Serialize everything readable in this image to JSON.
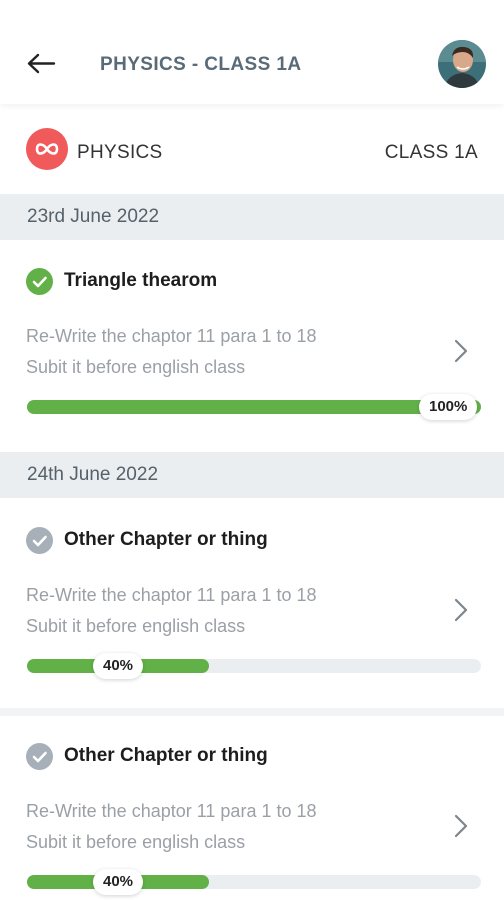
{
  "header": {
    "title": "PHYSICS - CLASS 1A",
    "back_icon": "arrow-left-icon",
    "avatar_icon": "user-avatar"
  },
  "subject": {
    "name": "PHYSICS",
    "class": "CLASS 1A",
    "logo_icon": "infinity-icon",
    "logo_color": "#f05a5a"
  },
  "colors": {
    "progress": "#62b148",
    "done": "#62b148",
    "pending": "#a7b0b8",
    "accent": "#5a6b78"
  },
  "groups": [
    {
      "date": "23rd June 2022",
      "tasks": [
        {
          "title": "Triangle thearom",
          "line1": "Re-Write the chaptor 11 para 1 to 18",
          "line2": "Subit it before english class",
          "progress": 100,
          "progress_label": "100%",
          "status": "completed"
        }
      ]
    },
    {
      "date": "24th June 2022",
      "tasks": [
        {
          "title": "Other Chapter or thing",
          "line1": "Re-Write the chaptor 11 para 1 to 18",
          "line2": "Subit it before english class",
          "progress": 40,
          "progress_label": "40%",
          "status": "pending"
        },
        {
          "title": "Other Chapter or thing",
          "line1": "Re-Write the chaptor 11 para 1 to 18",
          "line2": "Subit it before english class",
          "progress": 40,
          "progress_label": "40%",
          "status": "pending"
        }
      ]
    }
  ]
}
